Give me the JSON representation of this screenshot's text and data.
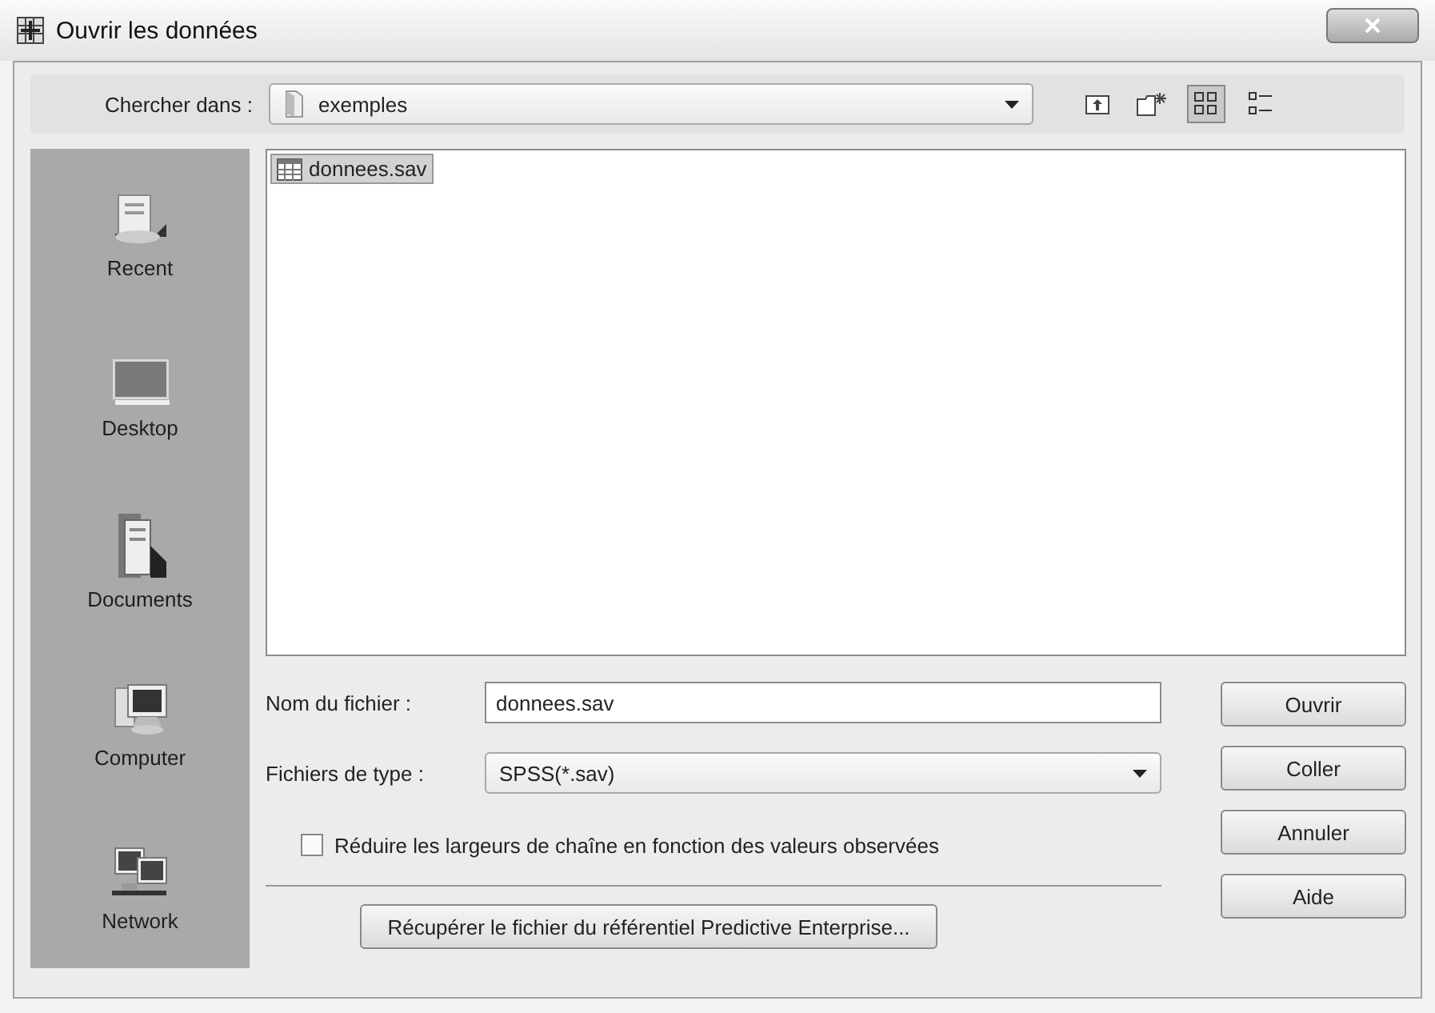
{
  "window": {
    "title": "Ouvrir les données"
  },
  "look_in": {
    "label": "Chercher dans :",
    "value": "exemples"
  },
  "toolbar": [
    {
      "kind": "up",
      "selected": false
    },
    {
      "kind": "new-folder",
      "selected": false
    },
    {
      "kind": "list",
      "selected": true
    },
    {
      "kind": "details",
      "selected": false
    }
  ],
  "places": [
    {
      "kind": "recent",
      "label": "Recent"
    },
    {
      "kind": "desktop",
      "label": "Desktop"
    },
    {
      "kind": "documents",
      "label": "Documents"
    },
    {
      "kind": "computer",
      "label": "Computer"
    },
    {
      "kind": "network",
      "label": "Network"
    }
  ],
  "files": [
    {
      "name": "donnees.sav",
      "selected": true
    }
  ],
  "file_name": {
    "label": "Nom du fichier :",
    "value": "donnees.sav"
  },
  "file_type": {
    "label": "Fichiers de type :",
    "value": "SPSS(*.sav)"
  },
  "option": {
    "label": "Réduire les largeurs de chaîne en fonction des valeurs observées",
    "checked": false
  },
  "repository_button": "Récupérer le fichier du référentiel Predictive Enterprise...",
  "buttons": [
    "Ouvrir",
    "Coller",
    "Annuler",
    "Aide"
  ]
}
